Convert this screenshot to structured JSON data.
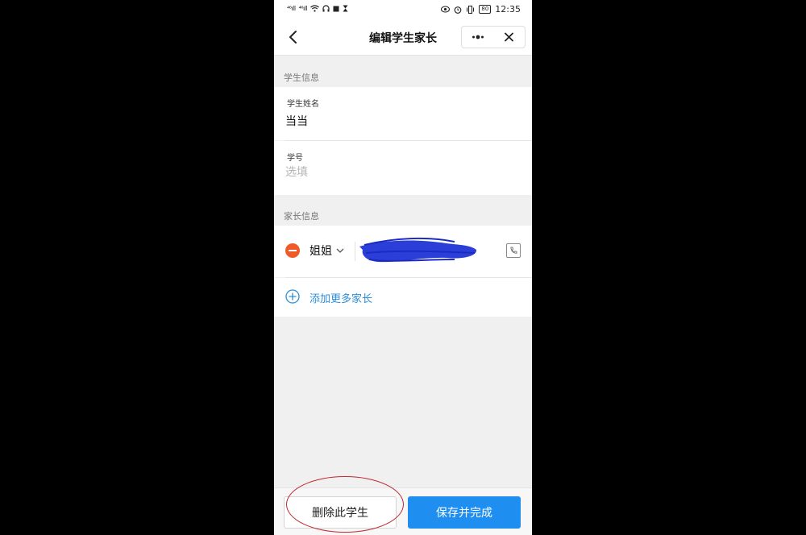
{
  "status_bar": {
    "signal_1": "⁴⁶ıll",
    "signal_2": "⁴⁶ıll",
    "battery": "80",
    "time": "12:35"
  },
  "navbar": {
    "title": "编辑学生家长",
    "back_icon": "chevron-left-icon",
    "more_icon": "more-dots-icon",
    "close_icon": "close-icon"
  },
  "student_section": {
    "header": "学生信息",
    "name_label": "学生姓名",
    "name_value": "当当",
    "id_label": "学号",
    "id_placeholder": "选填"
  },
  "parent_section": {
    "header": "家长信息",
    "parents": [
      {
        "relation": "姐姐",
        "phone_redacted": true
      }
    ],
    "add_label": "添加更多家长"
  },
  "footer": {
    "delete_label": "删除此学生",
    "save_label": "保存并完成"
  },
  "colors": {
    "accent": "#1e8ff0",
    "link": "#2c8ed8",
    "remove": "#f05a28",
    "redaction": "#2b3fd8",
    "annotation": "#c0282d"
  }
}
